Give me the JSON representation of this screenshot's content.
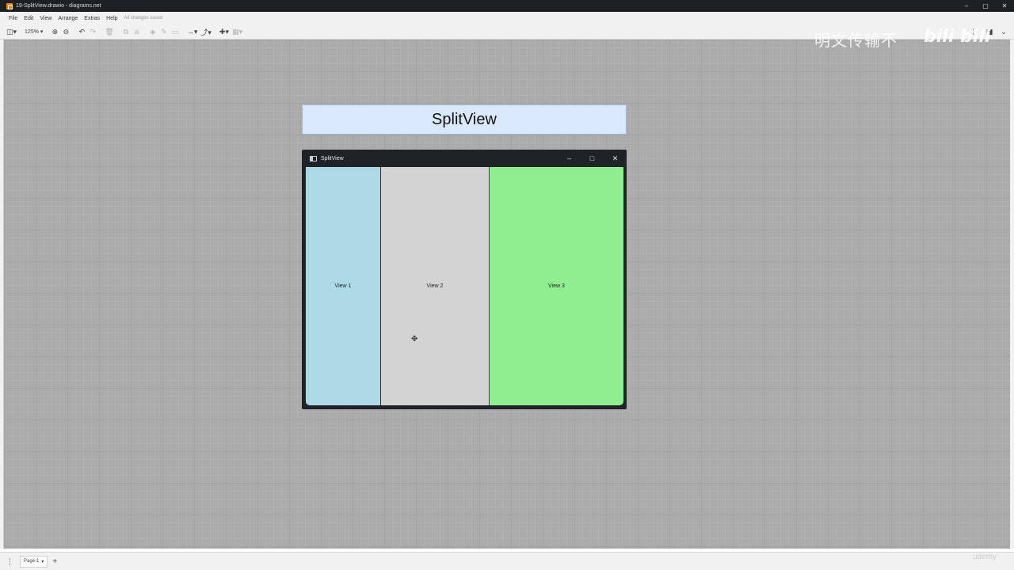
{
  "window": {
    "title": "19-SplitView.drawio - diagrams.net",
    "min": "–",
    "max": "▢",
    "close": "✕"
  },
  "menu": {
    "items": [
      "File",
      "Edit",
      "View",
      "Arrange",
      "Extras",
      "Help"
    ],
    "status": "All changes saved"
  },
  "toolbar": {
    "zoom": "125%"
  },
  "diagram": {
    "header": "SplitView",
    "mock_window": {
      "title": "SplitView",
      "min": "–",
      "max": "□",
      "close": "✕",
      "panes": [
        "View 1",
        "View 2",
        "View 3"
      ]
    }
  },
  "footer": {
    "page": "Page-1",
    "add": "+",
    "menu": "⋮"
  },
  "watermark": {
    "text": "明文传输不",
    "logo": "bili bili",
    "udemy": "udemy"
  },
  "colors": {
    "view1": "#add8e6",
    "view2": "#d3d3d3",
    "view3": "#90ee90",
    "header": "#dae8fc"
  }
}
